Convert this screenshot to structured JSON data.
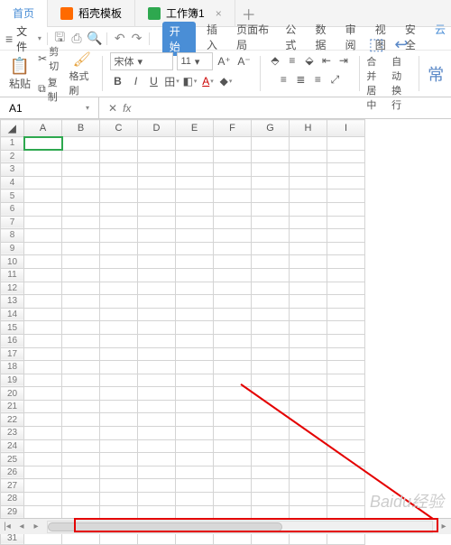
{
  "tabs": {
    "home": "首页",
    "template": "稻壳模板",
    "doc": "工作簿1"
  },
  "file_btn": "文件",
  "ribbon_tabs": {
    "start": "开始",
    "insert": "插入",
    "layout": "页面布局",
    "formula": "公式",
    "data": "数据",
    "review": "审阅",
    "view": "视图",
    "security": "安全",
    "clouds": "云"
  },
  "clip": {
    "paste": "粘贴",
    "cut": "剪切",
    "copy": "复制",
    "brush": "格式刷"
  },
  "font": {
    "name": "宋体",
    "size": "11"
  },
  "merge": "合并居中",
  "wrap": "自动换行",
  "namebox": "A1",
  "fx": "fx",
  "columns": [
    "A",
    "B",
    "C",
    "D",
    "E",
    "F",
    "G",
    "H",
    "I"
  ],
  "rows": 31,
  "watermark": "Baidu经验"
}
